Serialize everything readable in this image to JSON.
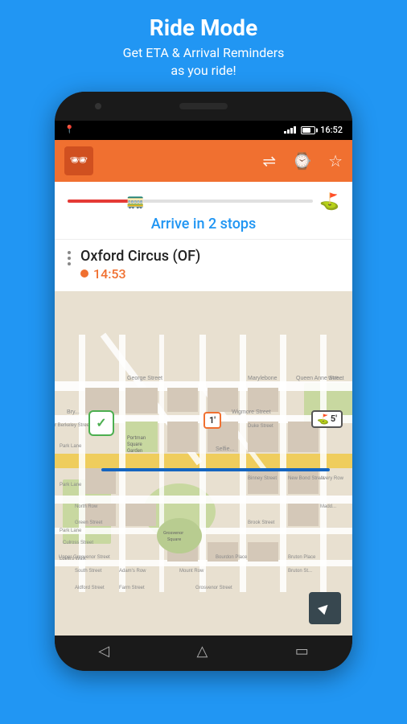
{
  "header": {
    "title": "Ride Mode",
    "subtitle_line1": "Get ETA & Arrival Reminders",
    "subtitle_line2": "as you ride!"
  },
  "status_bar": {
    "time": "16:52",
    "location_icon": "📍"
  },
  "toolbar": {
    "logo_icon": "🕶",
    "transfer_icon": "⇄",
    "watch_icon": "⌚",
    "star_icon": "☆"
  },
  "progress": {
    "arrive_text": "Arrive in 2 stops",
    "train_icon": "🚃",
    "flag_icon": "🏁",
    "fill_percent": 28
  },
  "station": {
    "name": "Oxford Circus (OF)",
    "time": "14:53"
  },
  "map": {
    "route_label_mid": "1'",
    "route_label_end": "5'",
    "nav_icon": "◀"
  },
  "bottom_nav": {
    "back_icon": "◁",
    "home_icon": "△",
    "recent_icon": "▭"
  }
}
